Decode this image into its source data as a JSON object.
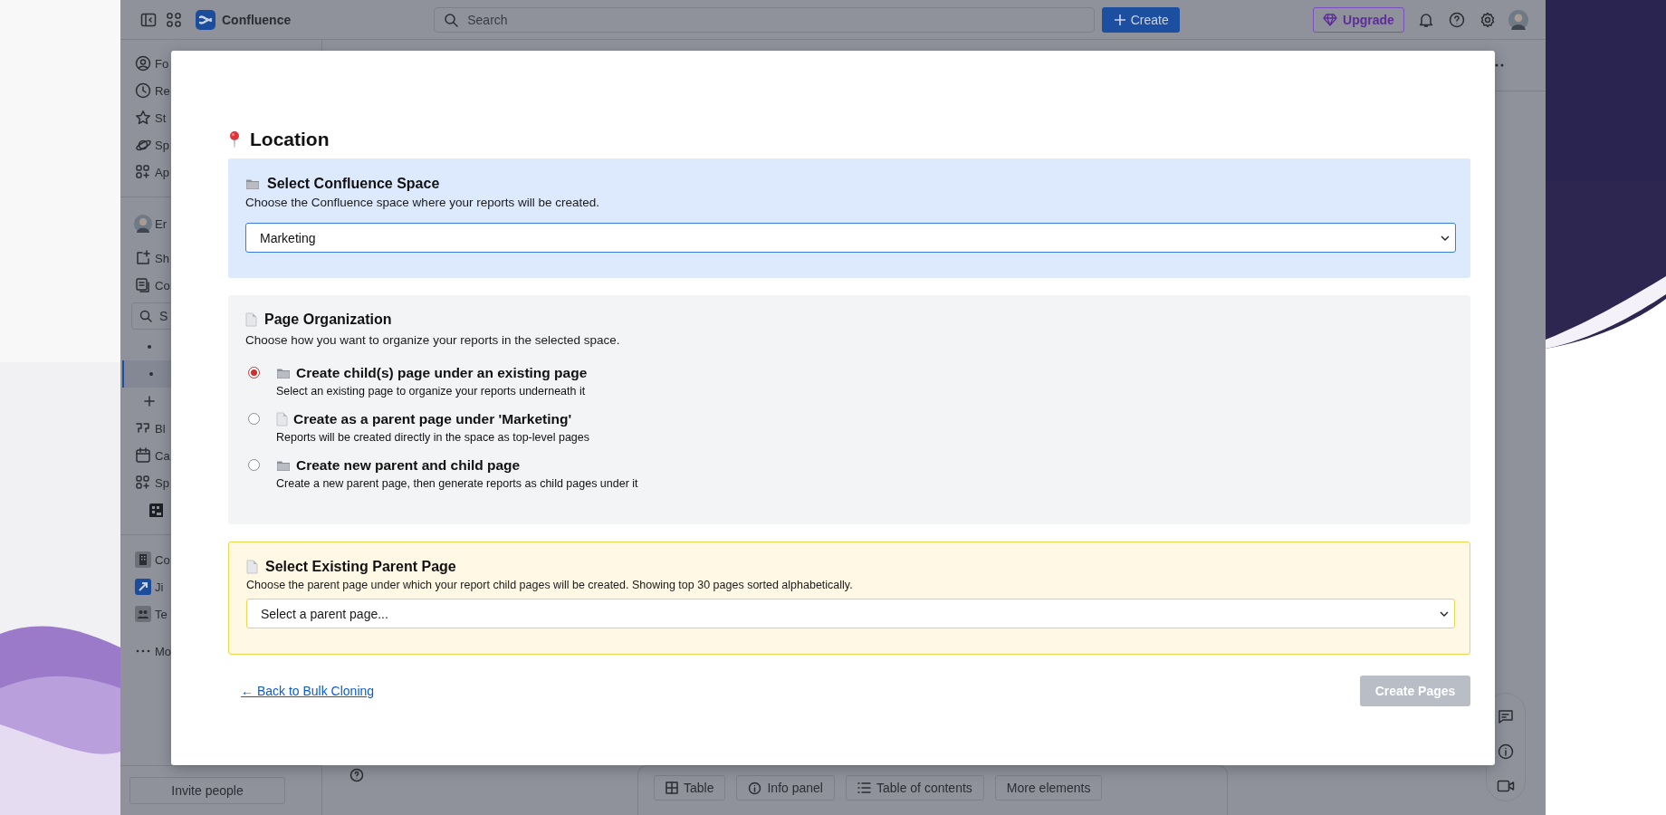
{
  "topbar": {
    "product": "Confluence",
    "search": {
      "placeholder": "Search"
    },
    "create_button": "Create",
    "upgrade_button": "Upgrade"
  },
  "sidebar": {
    "nav": [
      {
        "label": "Fo"
      },
      {
        "label": "Re"
      },
      {
        "label": "St"
      },
      {
        "label": "Sp"
      },
      {
        "label": "Ap"
      }
    ],
    "space": {
      "owner": "Er",
      "items": [
        {
          "label": "Sh"
        },
        {
          "label": "Co"
        }
      ],
      "search": {
        "placeholder": "S"
      },
      "tree": [
        {
          "selected": false
        },
        {
          "selected": true
        }
      ],
      "more": [
        {
          "label": "Bl"
        },
        {
          "label": "Ca"
        },
        {
          "label": "Sp"
        }
      ]
    },
    "apps": [
      {
        "label": "Co"
      },
      {
        "label": "Ji"
      },
      {
        "label": "Te"
      }
    ],
    "more_label": "Mo",
    "invite_button": "Invite people"
  },
  "editor": {
    "elements": [
      "Table",
      "Info panel",
      "Table of contents",
      "More elements"
    ]
  },
  "modal": {
    "title": "Location",
    "space_section": {
      "title": "Select Confluence Space",
      "description": "Choose the Confluence space where your reports will be created.",
      "value": "Marketing"
    },
    "organization": {
      "title": "Page Organization",
      "description": "Choose how you want to organize your reports in the selected space.",
      "options": [
        {
          "label": "Create child(s) page under an existing page",
          "hint": "Select an existing page to organize your reports underneath it",
          "selected": true
        },
        {
          "label": "Create as a parent page under 'Marketing'",
          "hint": "Reports will be created directly in the space as top-level pages",
          "selected": false
        },
        {
          "label": "Create new parent and child page",
          "hint": "Create a new parent page, then generate reports as child pages under it",
          "selected": false
        }
      ]
    },
    "parent_section": {
      "title": "Select Existing Parent Page",
      "description": "Choose the parent page under which your report child pages will be created. Showing top 30 pages sorted alphabetically.",
      "placeholder": "Select a parent page..."
    },
    "back_link": "← Back to Bulk Cloning",
    "submit_button": {
      "label": "Create Pages",
      "disabled": true
    }
  }
}
